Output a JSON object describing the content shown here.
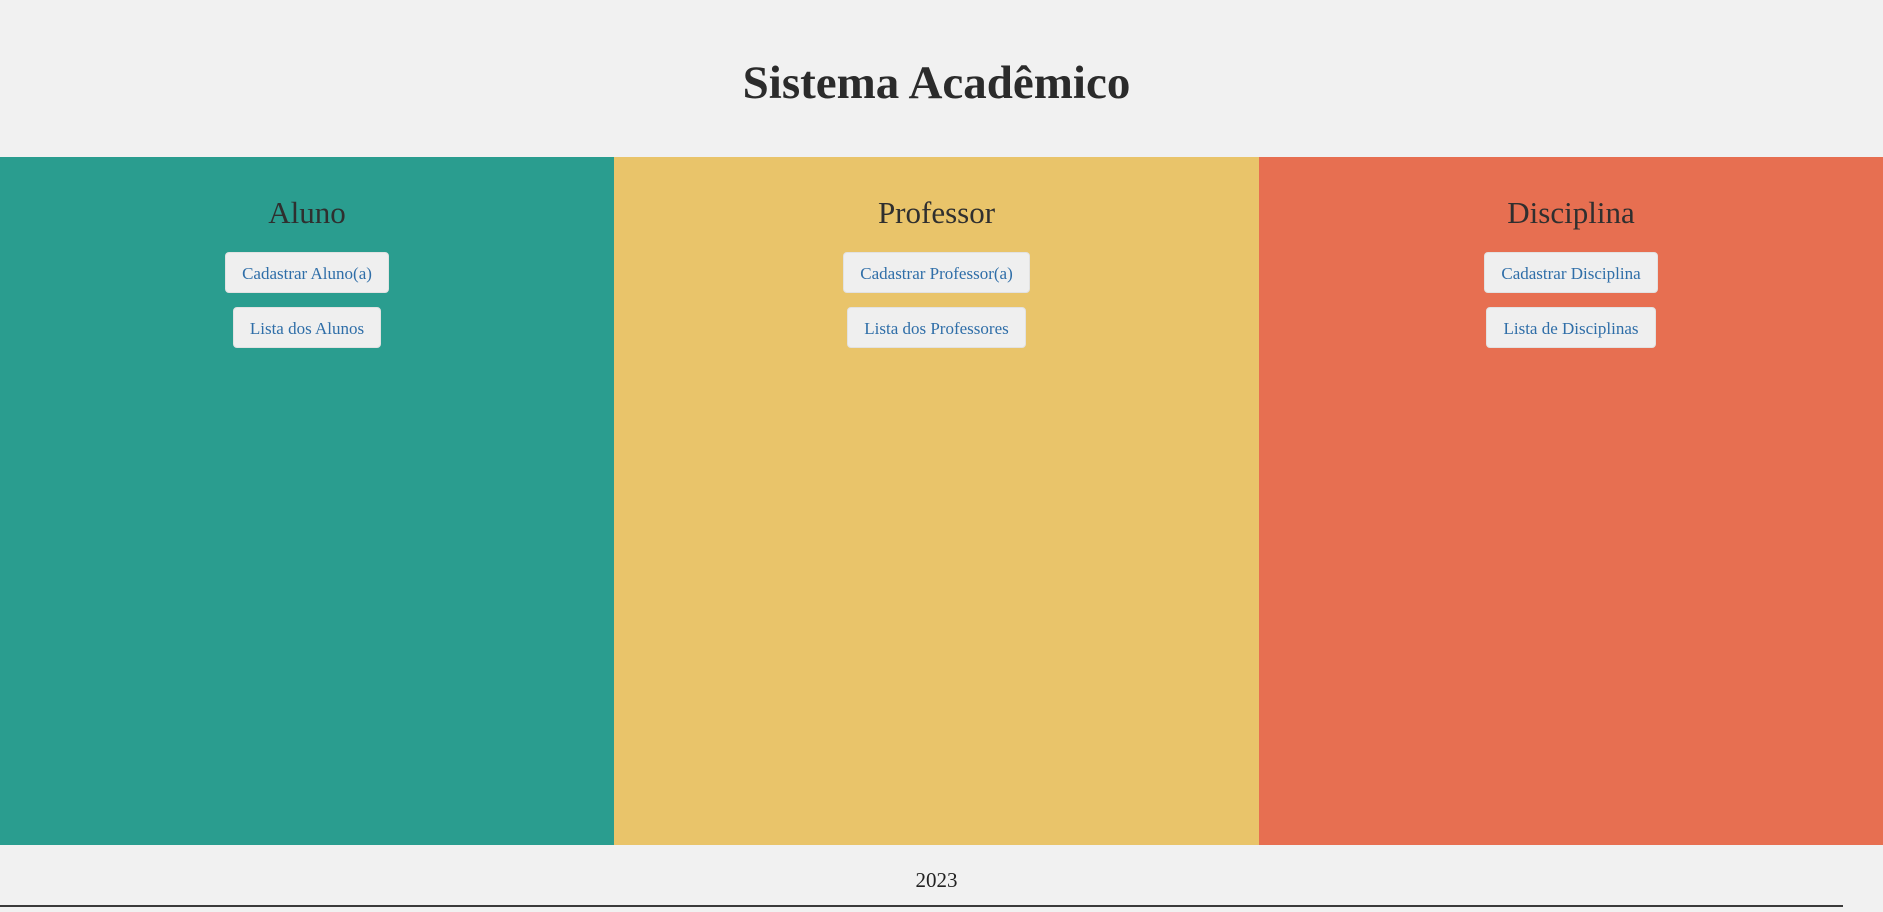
{
  "header": {
    "title": "Sistema Acadêmico"
  },
  "panels": [
    {
      "title": "Aluno",
      "color": "#2a9d8f",
      "buttons": [
        "Cadastrar Aluno(a)",
        "Lista dos Alunos"
      ]
    },
    {
      "title": "Professor",
      "color": "#e9c46a",
      "buttons": [
        "Cadastrar Professor(a)",
        "Lista dos Professores"
      ]
    },
    {
      "title": "Disciplina",
      "color": "#e76f51",
      "buttons": [
        "Cadastrar Disciplina",
        "Lista de Disciplinas"
      ]
    }
  ],
  "footer": {
    "text": "2023"
  }
}
